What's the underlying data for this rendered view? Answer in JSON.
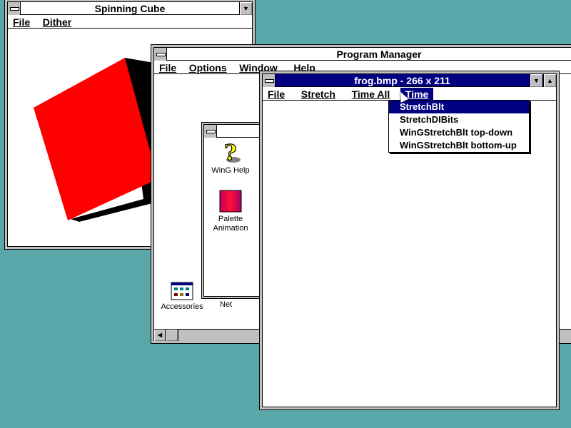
{
  "spinning_cube": {
    "title": "Spinning Cube",
    "menu": [
      "File",
      "Dither"
    ]
  },
  "program_manager": {
    "title": "Program Manager",
    "menu": [
      "File",
      "Options",
      "Window",
      "Help"
    ],
    "icons": {
      "wing_help": "WinG Help",
      "palette_animation_line1": "Palette",
      "palette_animation_line2": "Animation",
      "accessories": "Accessories",
      "network_partial": "Net"
    }
  },
  "frog": {
    "title": "frog.bmp - 266 x 211",
    "menu": [
      "File",
      "Stretch",
      "Time All",
      "Time"
    ],
    "dropdown": [
      "StretchBlt",
      "StretchDIBits",
      "WinGStretchBlt top-down",
      "WinGStretchBlt bottom-up"
    ]
  },
  "colors": {
    "desktop": "#5aa7a9",
    "active_title": "#000080",
    "cube_red": "#ff0000",
    "cube_shadow": "#000000"
  }
}
